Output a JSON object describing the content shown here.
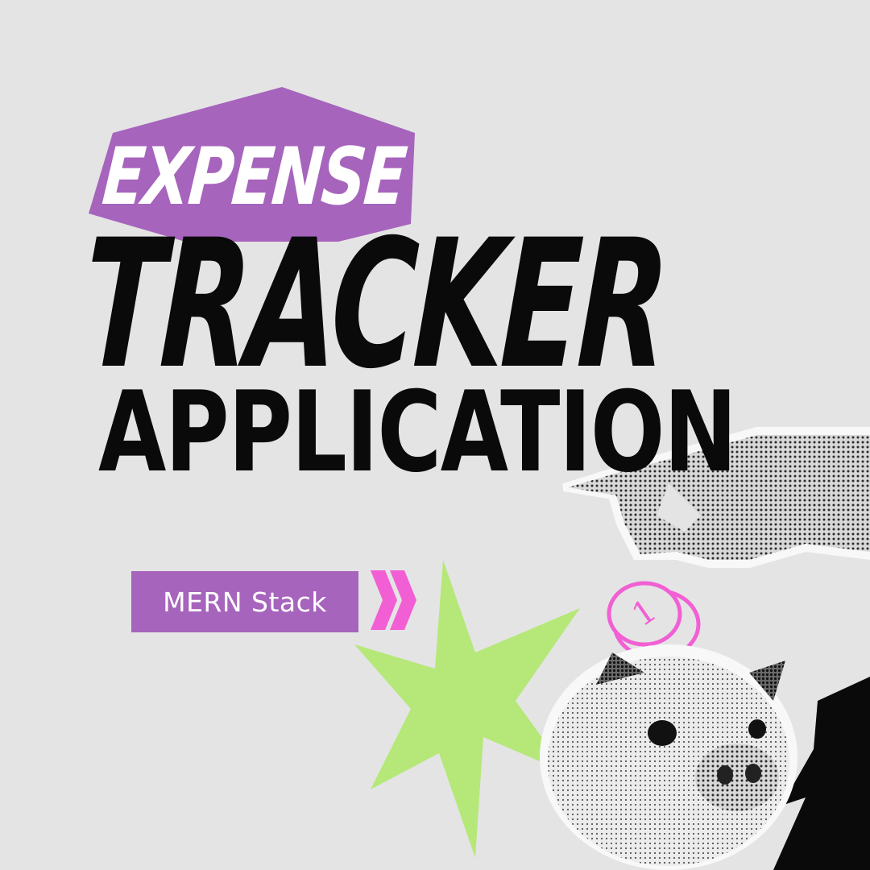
{
  "title": {
    "line1": "EXPENSE",
    "line2": "TRACKER",
    "line3": "APPLICATION"
  },
  "badge": {
    "label": "MERN Stack"
  },
  "coin": {
    "label": "1"
  },
  "icons": {
    "arrows": "double-chevron-right-icon",
    "star": "starburst-shape",
    "hand": "hand-holding-coin-illustration",
    "coin": "coin-icon",
    "pig": "piggy-bank-illustration"
  },
  "colors": {
    "background": "#e4e4e4",
    "purple": "#a664bc",
    "pink": "#f25fd4",
    "green": "#b5e878",
    "black": "#0a0a0a"
  }
}
